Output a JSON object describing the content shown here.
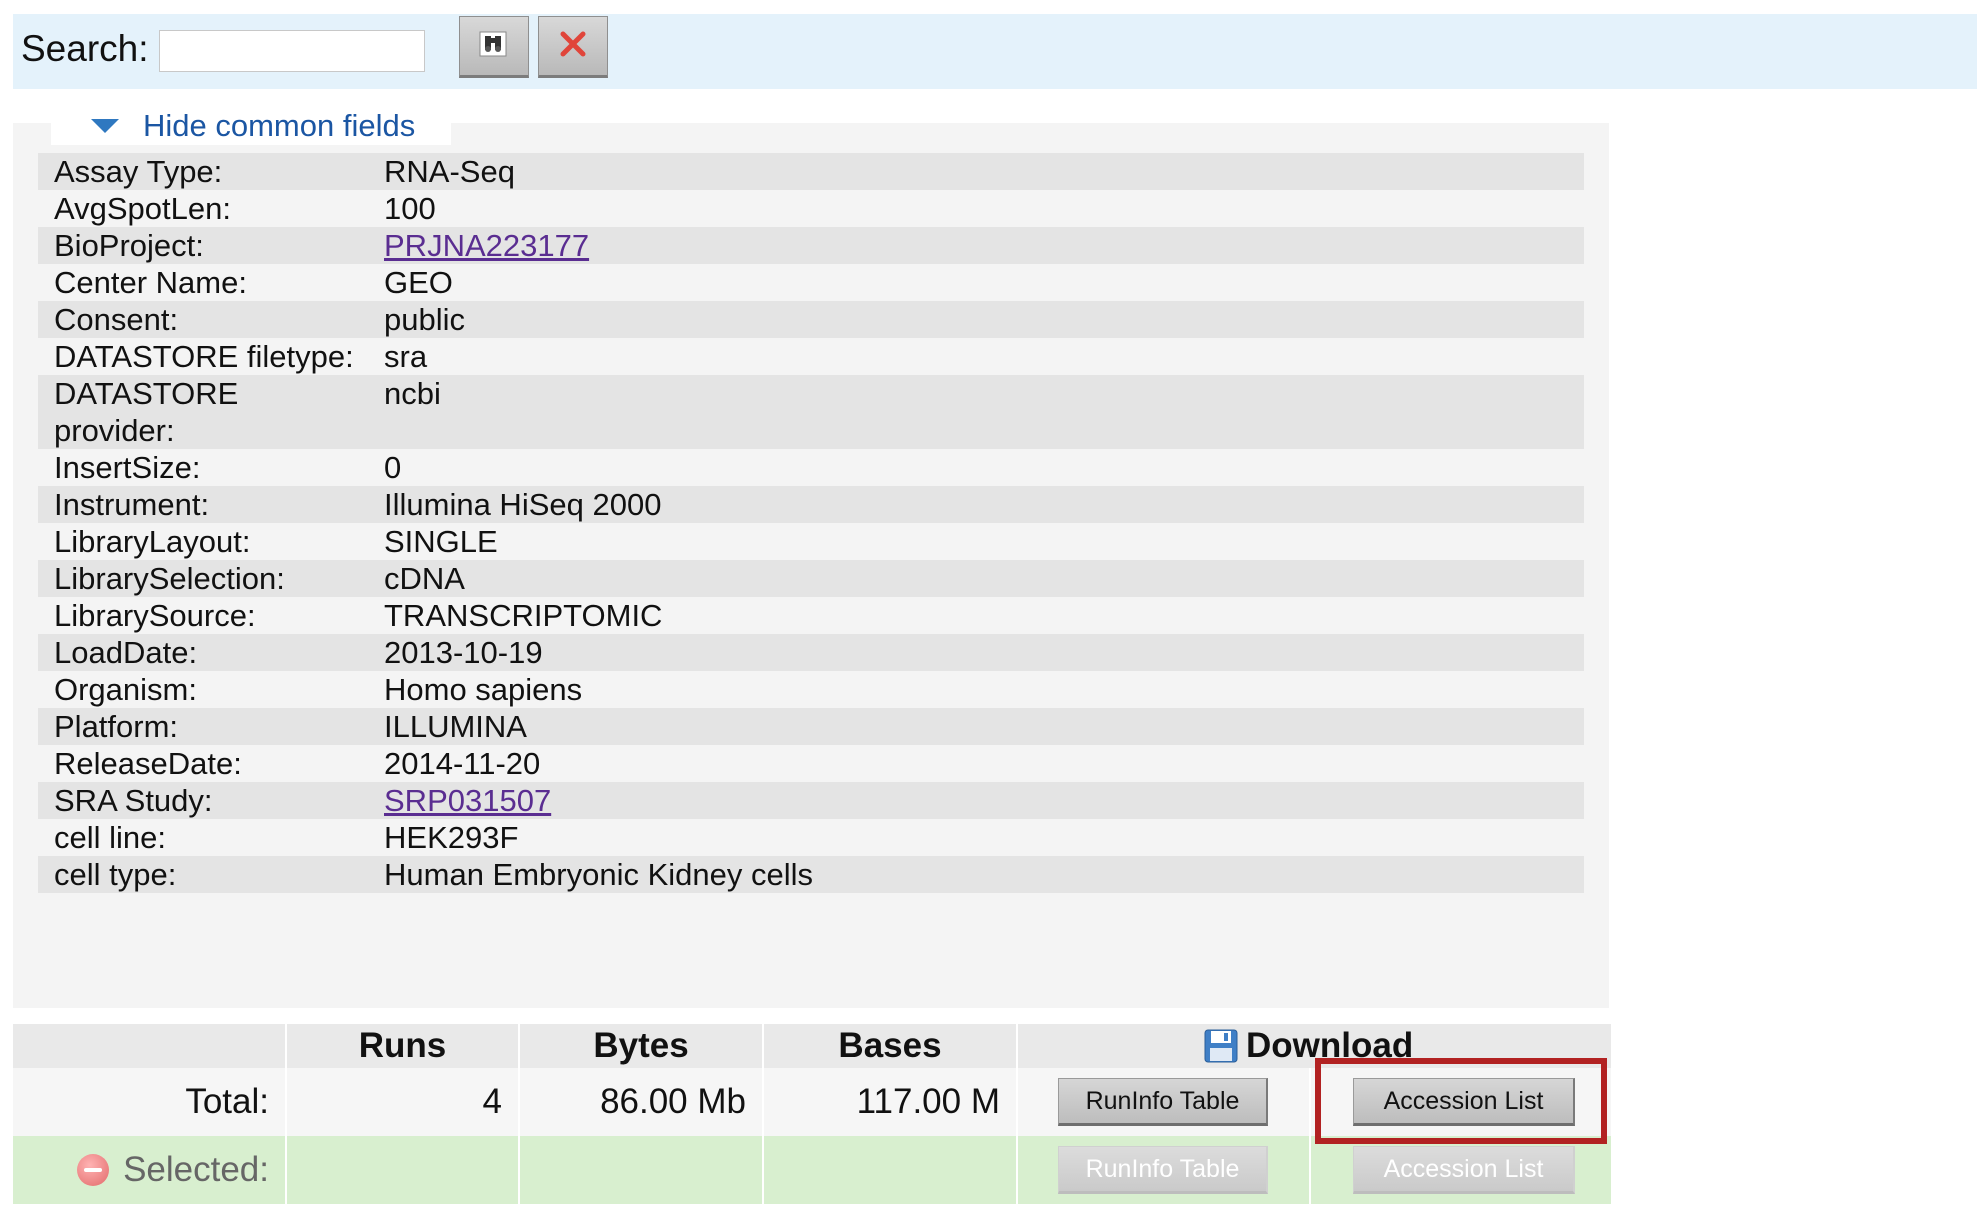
{
  "search": {
    "label": "Search:",
    "value": "",
    "placeholder": ""
  },
  "toolbar": {
    "find_icon": "binoculars-icon",
    "clear_icon": "red-x-icon"
  },
  "common_fields": {
    "toggle_label": "Hide common fields",
    "rows": [
      {
        "key": "Assay Type:",
        "value": "RNA-Seq"
      },
      {
        "key": "AvgSpotLen:",
        "value": "100"
      },
      {
        "key": "BioProject:",
        "value": "PRJNA223177",
        "link": true
      },
      {
        "key": "Center Name:",
        "value": "GEO"
      },
      {
        "key": "Consent:",
        "value": "public"
      },
      {
        "key": "DATASTORE filetype:",
        "value": "sra"
      },
      {
        "key": "DATASTORE provider:",
        "value": "ncbi"
      },
      {
        "key": "InsertSize:",
        "value": "0"
      },
      {
        "key": "Instrument:",
        "value": "Illumina HiSeq 2000"
      },
      {
        "key": "LibraryLayout:",
        "value": "SINGLE"
      },
      {
        "key": "LibrarySelection:",
        "value": "cDNA"
      },
      {
        "key": "LibrarySource:",
        "value": "TRANSCRIPTOMIC"
      },
      {
        "key": "LoadDate:",
        "value": "2013-10-19"
      },
      {
        "key": "Organism:",
        "value": "Homo sapiens"
      },
      {
        "key": "Platform:",
        "value": "ILLUMINA"
      },
      {
        "key": "ReleaseDate:",
        "value": "2014-11-20"
      },
      {
        "key": "SRA Study:",
        "value": "SRP031507",
        "link": true
      },
      {
        "key": "cell line:",
        "value": "HEK293F"
      },
      {
        "key": "cell type:",
        "value": "Human Embryonic Kidney cells"
      }
    ]
  },
  "summary": {
    "headers": {
      "runs": "Runs",
      "bytes": "Bytes",
      "bases": "Bases",
      "download": "Download"
    },
    "total": {
      "label": "Total:",
      "runs": "4",
      "bytes": "86.00 Mb",
      "bases": "117.00 M"
    },
    "selected": {
      "label": "Selected:"
    },
    "buttons": {
      "runinfo_table": "RunInfo Table",
      "accession_list": "Accession List"
    }
  },
  "colors": {
    "search_bar_bg": "#e4f2fb",
    "link": "#5a2d91",
    "toggle_link": "#1b56a3",
    "highlight": "#b22222",
    "selected_row_bg": "#d8efcf"
  }
}
